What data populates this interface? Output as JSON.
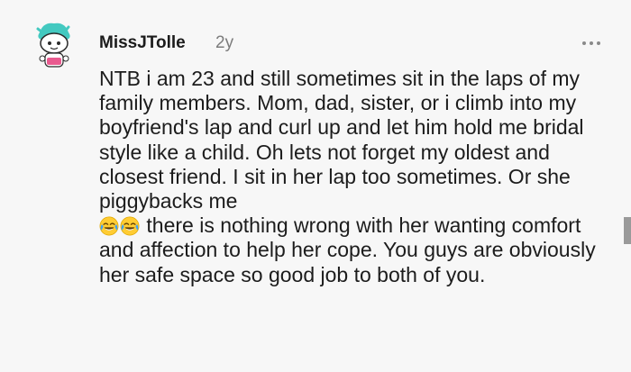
{
  "comment": {
    "author": "MissJTolle",
    "age": "2y",
    "text_before_emoji": "NTB i am 23 and still sometimes sit in the laps of my family members. Mom, dad, sister, or i climb into my boyfriend's lap and curl up and let him hold me bridal style like a child. Oh lets not forget my oldest and closest friend. I sit in her lap too sometimes. Or she piggybacks me",
    "text_after_emoji": " there is nothing wrong with her wanting comfort and affection to help her cope. You guys are obviously her safe space so good job to both of you.",
    "emojis": [
      "face-with-tears-of-joy-emoji",
      "face-with-tears-of-joy-emoji"
    ]
  },
  "icons": {
    "avatar": "snoo-avatar-icon",
    "menu": "more-options-icon"
  },
  "colors": {
    "background": "#f7f7f7",
    "text": "#1c1c1c",
    "muted": "#7c7c7c",
    "avatar_accent": "#43c9c0"
  }
}
